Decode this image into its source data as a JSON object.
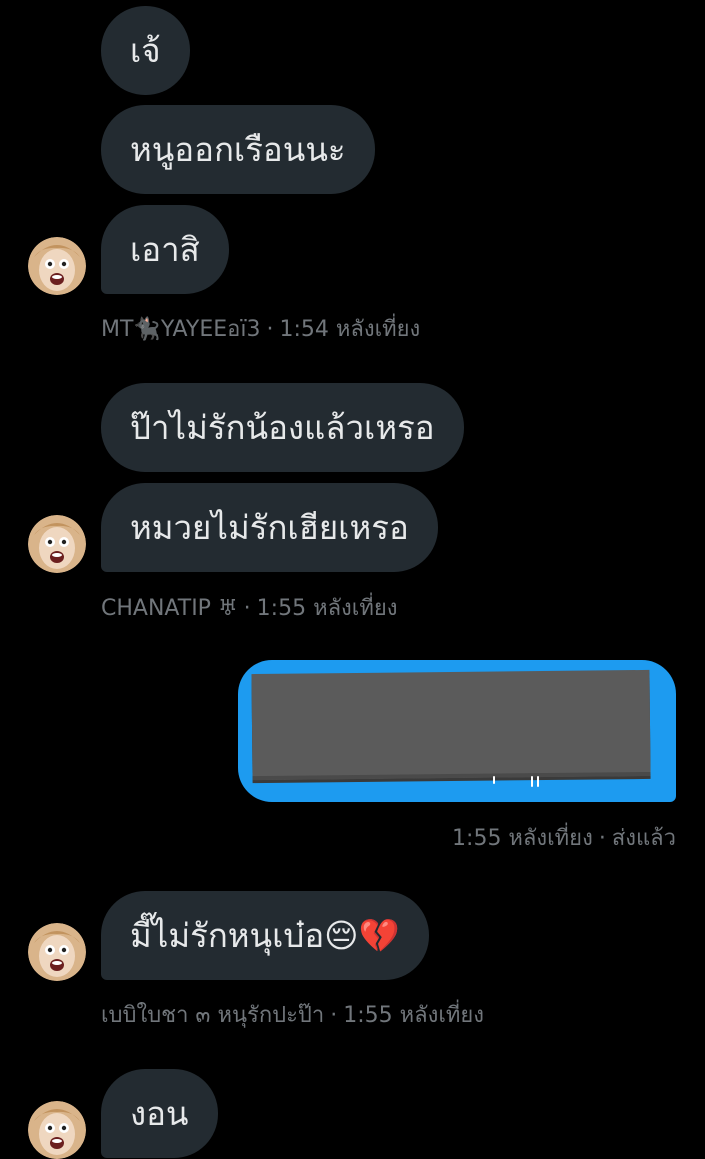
{
  "thread": {
    "group1": {
      "messages": [
        "เจ้",
        "หนูออกเรือนนะ",
        "เอาสิ"
      ],
      "sender": "MT🐈‍⬛YAYEEอï3",
      "time": "1:54 หลังเที่ยง"
    },
    "group2": {
      "messages": [
        "ป๊าไม่รักน้องแล้วเหรอ",
        "หมวยไม่รักเฮียเหรอ"
      ],
      "sender": "CHANATIP ♅",
      "time": "1:55 หลังเที่ยง"
    },
    "sent": {
      "time": "1:55 หลังเที่ยง",
      "status": "ส่งแล้ว"
    },
    "group3": {
      "messages": [
        "มี๊ไม่รักหนุเบ๋อ😔💔"
      ],
      "sender": "เบบิใบชา ๓ หนุรักปะป๊า",
      "time": "1:55 หลังเที่ยง"
    },
    "group4": {
      "messages": [
        "งอน"
      ]
    }
  },
  "colors": {
    "background": "#000000",
    "received_bubble": "#232b31",
    "sent_bubble": "#1d9bf0",
    "meta_text": "#71767b",
    "message_text": "#e7e9ea"
  },
  "icons": {
    "avatar": "cartoon-face-avatar"
  }
}
